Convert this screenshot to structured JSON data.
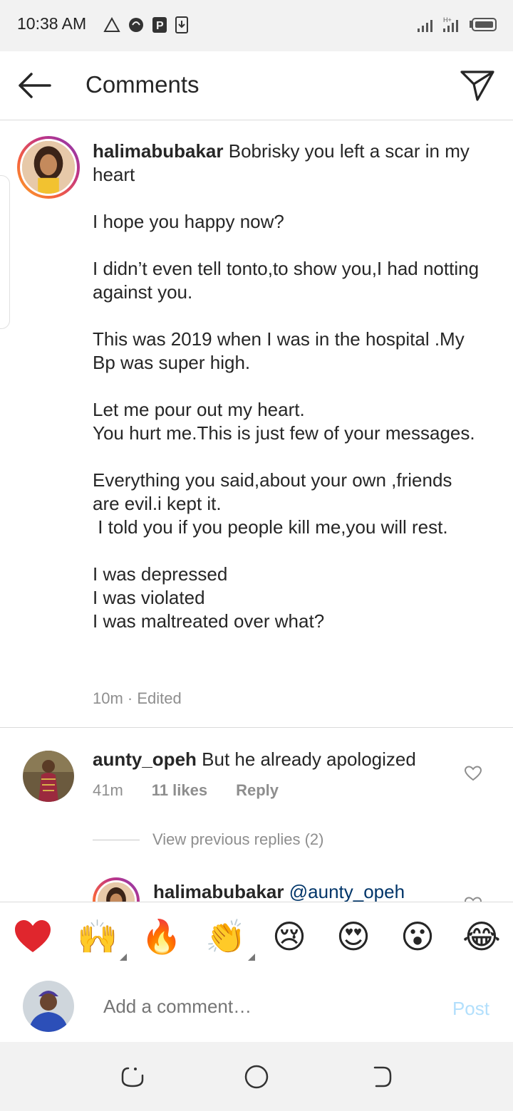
{
  "status_bar": {
    "time": "10:38 AM"
  },
  "header": {
    "title": "Comments"
  },
  "caption": {
    "username": "halimabubakar",
    "text": "Bobrisky you left a scar in my heart\n\nI hope you happy now?\n\nI didn’t even tell tonto,to show you,I had notting against you.\n\nThis was 2019 when I was in the hospital .My Bp was super high.\n\nLet me pour out my heart.\nYou hurt me.This is just few of your messages.\n\nEverything you said,about your own ,friends are evil.i kept it.\n I told you if you people kill me,you will rest.\n\nI was depressed\nI was violated\nI was maltreated over what?",
    "meta": "10m · Edited"
  },
  "comments": [
    {
      "username": "aunty_opeh",
      "text": "But he already apologized",
      "time": "41m",
      "likes": "11 likes",
      "reply": "Reply"
    }
  ],
  "view_replies": "View previous replies (2)",
  "reply_preview": {
    "username": "halimabubakar",
    "mention": "@aunty_opeh"
  },
  "emojis": [
    "❤️",
    "🙌",
    "🔥",
    "👏",
    "😢",
    "😍",
    "😮",
    "😂"
  ],
  "input": {
    "placeholder": "Add a comment…",
    "post_label": "Post"
  },
  "colors": {
    "link": "#003569",
    "post_disabled": "#b2dffc",
    "meta": "#8e8e8e"
  }
}
